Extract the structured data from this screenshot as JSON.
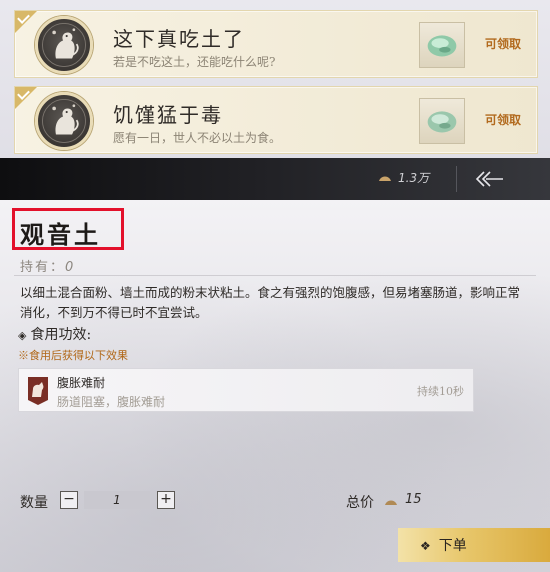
{
  "achievements": [
    {
      "title": "这下真吃土了",
      "desc": "若是不吃这土，还能吃什么呢?",
      "claim_label": "可领取",
      "icon": "monkey-emblem-icon",
      "reward_icon": "jade-reward-icon"
    },
    {
      "title": "饥馑猛于毒",
      "desc": "愿有一日，世人不必以土为食。",
      "claim_label": "可领取",
      "icon": "monkey-emblem-icon",
      "reward_icon": "jade-reward-icon"
    }
  ],
  "topbar": {
    "currency_value": "1.3万",
    "currency_icon": "coin-icon",
    "back_icon": "double-chevron-left-icon"
  },
  "item": {
    "name": "观音土",
    "holding_label": "持有：",
    "holding_value": "0",
    "description": "以细土混合面粉、墙土而成的粉末状粘土。食之有强烈的饱腹感，但易堵塞肠道，影响正常消化，不到万不得已时不宜尝试。",
    "effect_heading": "食用功效:",
    "effect_note": "※食用后获得以下效果",
    "buff": {
      "name": "腹胀难耐",
      "desc": "肠道阻塞，腹胀难耐",
      "duration": "持续10秒",
      "icon": "horse-buff-icon"
    }
  },
  "purchase": {
    "qty_label": "数量",
    "qty_value": "1",
    "minus_label": "−",
    "plus_label": "+",
    "total_label": "总价",
    "total_value": "15",
    "order_label": "下单"
  },
  "colors": {
    "claim": "#b26a1e",
    "highlight_box": "#e3102b",
    "effect_note": "#b06616",
    "button_gold": "#e7c66a"
  }
}
